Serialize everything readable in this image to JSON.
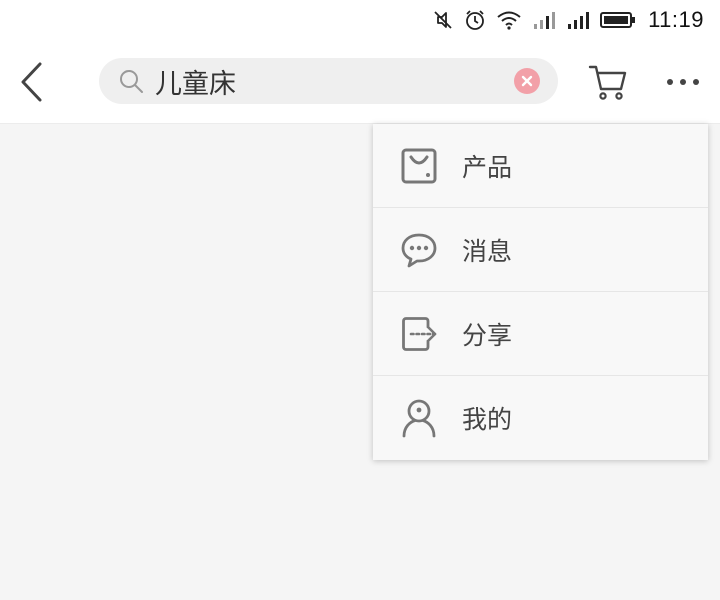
{
  "status_bar": {
    "time": "11:19",
    "icons": [
      "mute-icon",
      "alarm-icon",
      "wifi-icon",
      "signal-icon",
      "signal-icon",
      "battery-icon"
    ]
  },
  "header": {
    "back_icon": "chevron-left-icon",
    "search": {
      "value": "儿童床",
      "icon": "search-icon",
      "clear_icon": "clear-icon",
      "clear_color": "#f2a0a8"
    },
    "cart_icon": "cart-icon",
    "more_icon": "more-icon"
  },
  "menu": {
    "items": [
      {
        "label": "产品",
        "icon": "product-bag-icon"
      },
      {
        "label": "消息",
        "icon": "message-bubble-icon"
      },
      {
        "label": "分享",
        "icon": "share-icon"
      },
      {
        "label": "我的",
        "icon": "profile-icon"
      }
    ]
  }
}
